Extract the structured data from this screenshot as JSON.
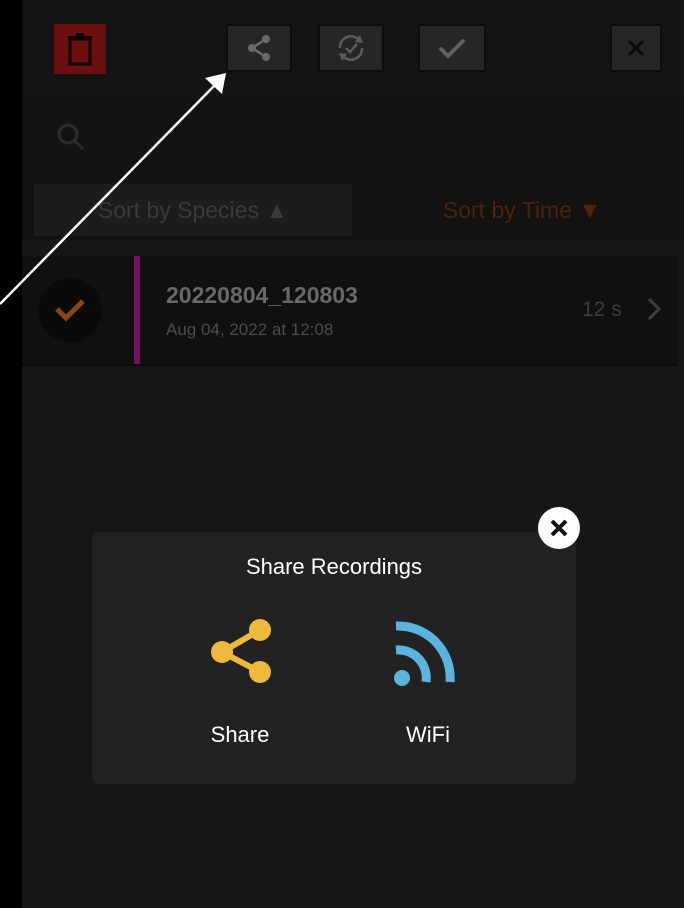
{
  "toolbar": {
    "delete_icon": "trash-icon",
    "share_icon": "share-icon",
    "sync_icon": "sync-icon",
    "select_all_icon": "checkmark-icon",
    "close_icon": "close-icon",
    "delete_color": "#6e0f0f"
  },
  "search": {
    "icon": "search-icon"
  },
  "sort": {
    "species_label": "Sort by Species ▲",
    "time_label": "Sort by Time ▼"
  },
  "recordings": [
    {
      "name": "20220804_120803",
      "date": "Aug 04, 2022 at 12:08",
      "duration": "12 s",
      "selected": true,
      "accent_color": "#7a1060"
    }
  ],
  "dialog": {
    "title": "Share Recordings",
    "options": [
      {
        "label": "Share",
        "icon": "share-icon",
        "color": "#f0b93c"
      },
      {
        "label": "WiFi",
        "icon": "wifi-icon",
        "color": "#5bb4de"
      }
    ],
    "close_icon": "close-icon"
  }
}
